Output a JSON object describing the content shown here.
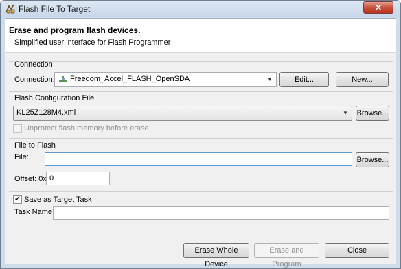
{
  "window": {
    "title": "Flash File To Target",
    "close_glyph": "✕"
  },
  "header": {
    "title": "Erase and program flash devices.",
    "subtitle": "Simplified user interface for Flash Programmer"
  },
  "connection": {
    "group_title": "Connection",
    "label": "Connection:",
    "selected": "Freedom_Accel_FLASH_OpenSDA",
    "icon": "debug-connection-icon",
    "edit_label": "Edit...",
    "new_label": "New..."
  },
  "flash_config": {
    "group_title": "Flash Configuration File",
    "selected": "KL25Z128M4.xml",
    "browse_label": "Browse...",
    "unprotect_label": "Unprotect flash memory before erase",
    "unprotect_checked": false
  },
  "file_to_flash": {
    "group_title": "File to Flash",
    "file_label": "File:",
    "file_value": "",
    "browse_label": "Browse...",
    "offset_label": "Offset: 0x",
    "offset_value": "0"
  },
  "target_task": {
    "save_label": "Save as Target Task",
    "save_checked": true,
    "task_name_label": "Task Name:",
    "task_name_value": ""
  },
  "footer": {
    "erase_label": "Erase Whole Device",
    "erase_program_label": "Erase and Program",
    "close_label": "Close"
  },
  "colors": {
    "title_bar": "#c7d6e9",
    "close_button": "#c9503c",
    "dialog_bg": "#f0f0f0",
    "focus_border": "#5b9bd5"
  }
}
